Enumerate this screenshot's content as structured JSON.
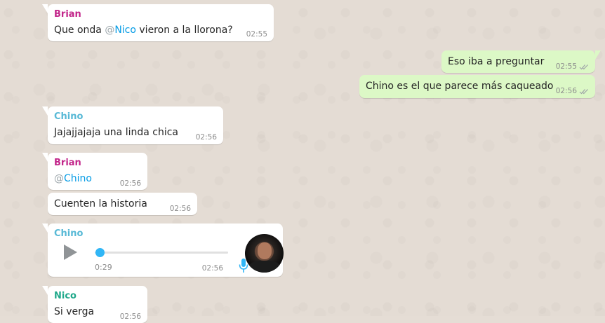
{
  "colors": {
    "brian": "#c2258a",
    "chino": "#58b9d6",
    "nico": "#1fa88a",
    "mention": "#039be5",
    "incoming_bg": "#ffffff",
    "outgoing_bg": "#dcf8c6",
    "read_ticks": "#9fa5a8",
    "mic": "#30b6f6"
  },
  "messages": [
    {
      "sender": "Brian",
      "prefix": "Que onda ",
      "mention_at": "@",
      "mention": "Nico",
      "suffix": " vieron a la llorona?",
      "time": "02:55"
    },
    {
      "text": "Eso iba a preguntar",
      "time": "02:55",
      "status_icon": "double-check-icon"
    },
    {
      "text": "Chino es el que parece más caqueado",
      "time": "02:56",
      "status_icon": "double-check-icon"
    },
    {
      "sender": "Chino",
      "text": "Jajajjajaja una linda chica",
      "time": "02:56"
    },
    {
      "sender": "Brian",
      "mention_at": "@",
      "mention": "Chino",
      "time": "02:56"
    },
    {
      "text": "Cuenten la historia",
      "time": "02:56"
    },
    {
      "sender": "Chino",
      "type": "voice-note",
      "duration": "0:29",
      "progress": 0,
      "time": "02:56",
      "icons": [
        "play-icon",
        "mic-icon"
      ]
    },
    {
      "sender": "Nico",
      "text": "Si verga",
      "time": "02:56"
    }
  ]
}
